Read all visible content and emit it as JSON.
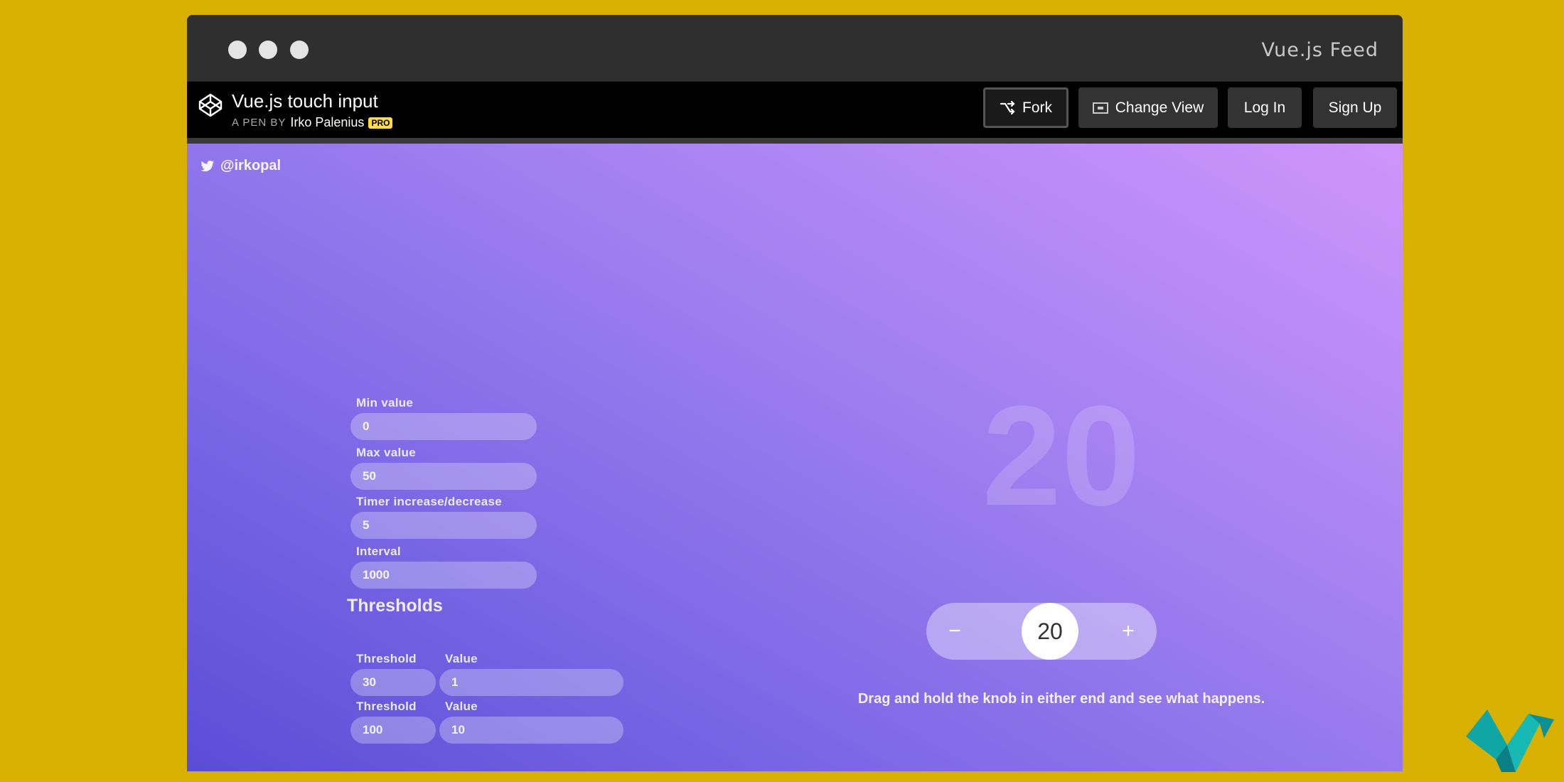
{
  "window": {
    "title": "Vue.js Feed"
  },
  "header": {
    "pen_title": "Vue.js touch input",
    "by_prefix": "A PEN BY",
    "author": "Irko Palenius",
    "badge": "PRO",
    "buttons": {
      "fork": "Fork",
      "change_view": "Change View",
      "log_in": "Log In",
      "sign_up": "Sign Up"
    }
  },
  "twitter_handle": "@irkopal",
  "settings": {
    "min_label": "Min value",
    "min_value": "0",
    "max_label": "Max value",
    "max_value": "50",
    "timer_label": "Timer increase/decrease",
    "timer_value": "5",
    "interval_label": "Interval",
    "interval_value": "1000"
  },
  "thresholds": {
    "title": "Thresholds",
    "rows": [
      {
        "threshold_label": "Threshold",
        "threshold": "30",
        "value_label": "Value",
        "value": "1"
      },
      {
        "threshold_label": "Threshold",
        "threshold": "100",
        "value_label": "Value",
        "value": "10"
      }
    ]
  },
  "display": {
    "big_number": "20",
    "knob_value": "20",
    "minus": "−",
    "plus": "+",
    "hint": "Drag and hold the knob in either end and see what happens."
  },
  "colors": {
    "background": "#d7b000",
    "header": "#000000",
    "gradient_start": "#5a4dd6",
    "gradient_end": "#cf95fb"
  }
}
